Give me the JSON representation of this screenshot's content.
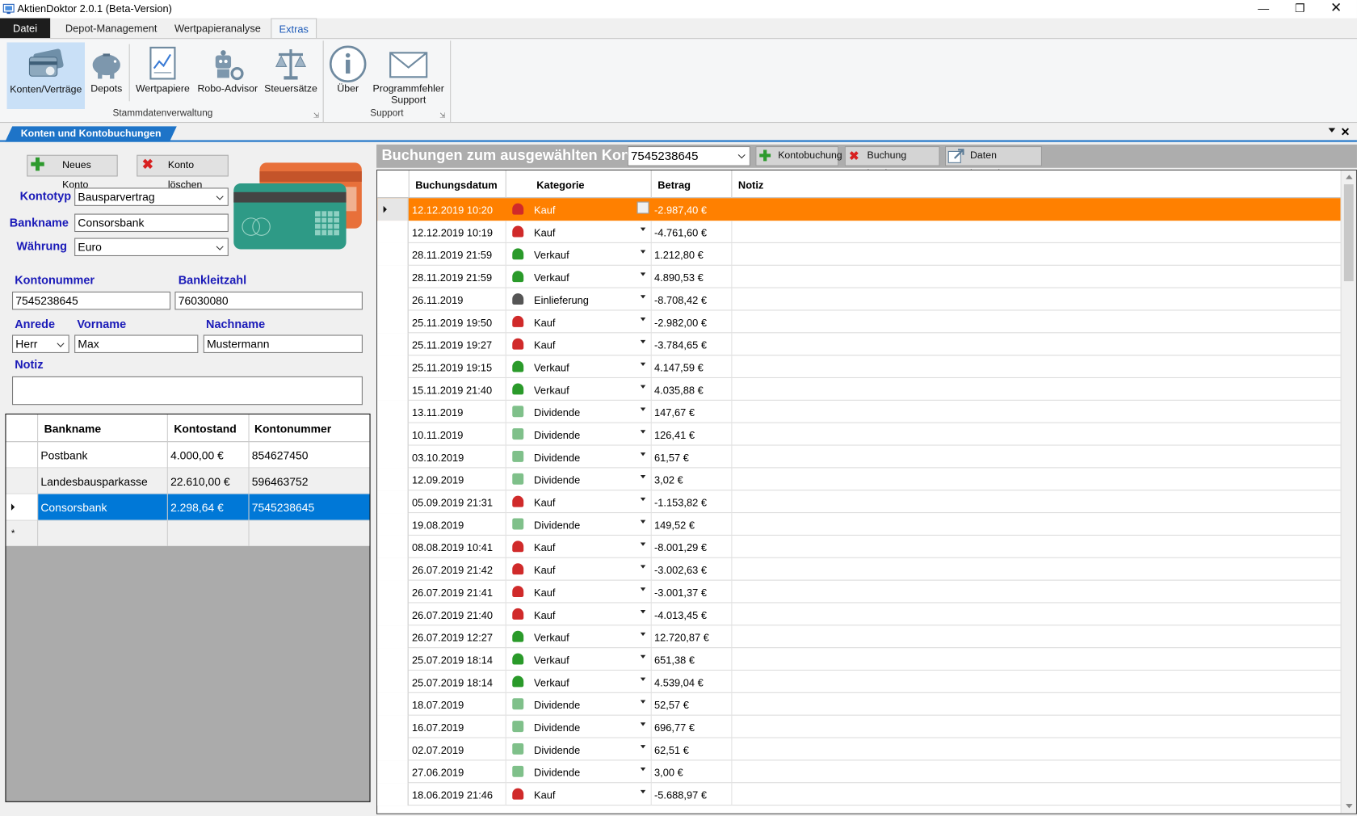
{
  "window": {
    "title": "AktienDoktor 2.0.1 (Beta-Version)"
  },
  "tabs": [
    "Datei",
    "Depot-Management",
    "Wertpapieranalyse",
    "Extras"
  ],
  "ribbon": {
    "buttons": [
      "Konten/Verträge",
      "Depots",
      "Wertpapiere",
      "Robo-Advisor",
      "Steuersätze",
      "Über",
      "Programmfehler",
      "Support"
    ],
    "groups": [
      "Stammdatenverwaltung",
      "Support"
    ]
  },
  "panel": {
    "tab": "Konten und Kontobuchungen"
  },
  "left": {
    "new_account": "Neues Konto",
    "delete_account": "Konto löschen",
    "labels": {
      "kontotyp": "Kontotyp",
      "bankname": "Bankname",
      "waehrung": "Währung",
      "kontonummer": "Kontonummer",
      "bankleitzahl": "Bankleitzahl",
      "anrede": "Anrede",
      "vorname": "Vorname",
      "nachname": "Nachname",
      "notiz": "Notiz"
    },
    "values": {
      "kontotyp": "Bausparvertrag",
      "bankname": "Consorsbank",
      "waehrung": "Euro",
      "kontonummer": "7545238645",
      "bankleitzahl": "76030080",
      "anrede": "Herr",
      "vorname": "Max",
      "nachname": "Mustermann",
      "notiz": ""
    },
    "table": {
      "headers": [
        "Bankname",
        "Kontostand",
        "Kontonummer"
      ],
      "rows": [
        [
          "Postbank",
          "4.000,00 €",
          "854627450"
        ],
        [
          "Landesbausparkasse",
          "22.610,00 €",
          "596463752"
        ],
        [
          "Consorsbank",
          "2.298,64 €",
          "7545238645"
        ]
      ],
      "new_row_marker": "*"
    }
  },
  "right": {
    "title": "Buchungen zum ausgewählten Konto",
    "account_select": "7545238645",
    "buttons": [
      "Kontobuchung",
      "Buchung löschen",
      "Daten importieren"
    ],
    "headers": [
      "Buchungsdatum",
      "Kategorie",
      "Betrag",
      "Notiz"
    ],
    "rows": [
      [
        "12.12.2019 10:20",
        "Kauf",
        "-2.987,40 €"
      ],
      [
        "12.12.2019 10:19",
        "Kauf",
        "-4.761,60 €"
      ],
      [
        "28.11.2019 21:59",
        "Verkauf",
        "1.212,80 €"
      ],
      [
        "28.11.2019 21:59",
        "Verkauf",
        "4.890,53 €"
      ],
      [
        "26.11.2019",
        "Einlieferung",
        "-8.708,42 €"
      ],
      [
        "25.11.2019 19:50",
        "Kauf",
        "-2.982,00 €"
      ],
      [
        "25.11.2019 19:27",
        "Kauf",
        "-3.784,65 €"
      ],
      [
        "25.11.2019 19:15",
        "Verkauf",
        "4.147,59 €"
      ],
      [
        "15.11.2019 21:40",
        "Verkauf",
        "4.035,88 €"
      ],
      [
        "13.11.2019",
        "Dividende",
        "147,67 €"
      ],
      [
        "10.11.2019",
        "Dividende",
        "126,41 €"
      ],
      [
        "03.10.2019",
        "Dividende",
        "61,57 €"
      ],
      [
        "12.09.2019",
        "Dividende",
        "3,02 €"
      ],
      [
        "05.09.2019 21:31",
        "Kauf",
        "-1.153,82 €"
      ],
      [
        "19.08.2019",
        "Dividende",
        "149,52 €"
      ],
      [
        "08.08.2019 10:41",
        "Kauf",
        "-8.001,29 €"
      ],
      [
        "26.07.2019 21:42",
        "Kauf",
        "-3.002,63 €"
      ],
      [
        "26.07.2019 21:41",
        "Kauf",
        "-3.001,37 €"
      ],
      [
        "26.07.2019 21:40",
        "Kauf",
        "-4.013,45 €"
      ],
      [
        "26.07.2019 12:27",
        "Verkauf",
        "12.720,87 €"
      ],
      [
        "25.07.2019 18:14",
        "Verkauf",
        "651,38 €"
      ],
      [
        "25.07.2019 18:14",
        "Verkauf",
        "4.539,04 €"
      ],
      [
        "18.07.2019",
        "Dividende",
        "52,57 €"
      ],
      [
        "16.07.2019",
        "Dividende",
        "696,77 €"
      ],
      [
        "02.07.2019",
        "Dividende",
        "62,51 €"
      ],
      [
        "27.06.2019",
        "Dividende",
        "3,00 €"
      ],
      [
        "18.06.2019 21:46",
        "Kauf",
        "-5.688,97 €"
      ]
    ]
  },
  "colors": {
    "accent": "#1e74c8",
    "selected_row": "#ff8000",
    "label": "#1a1ab8"
  }
}
